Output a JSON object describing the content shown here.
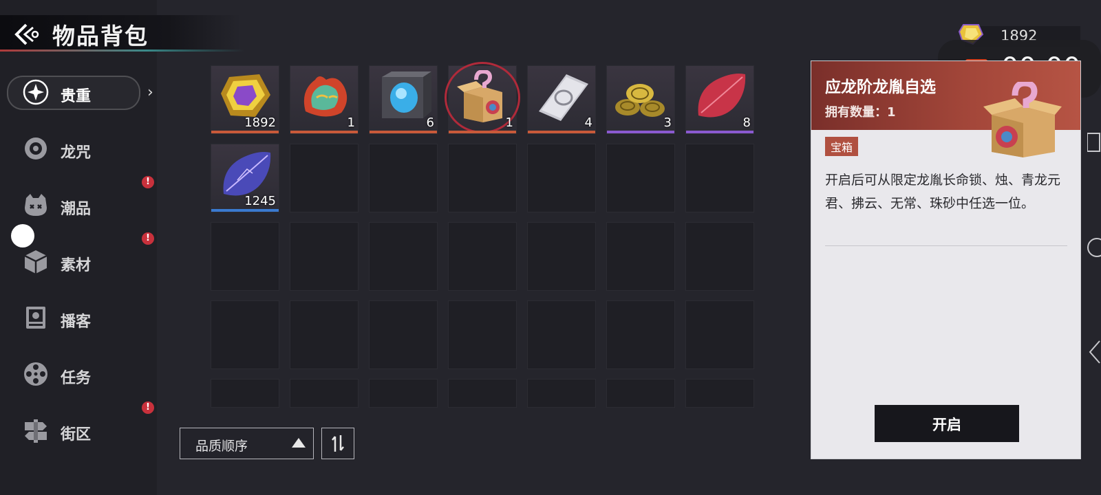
{
  "header": {
    "title": "物品背包",
    "back_icon": "back-arrow-icon"
  },
  "currency": {
    "value": "1892",
    "icon": "gem-icon"
  },
  "recording": {
    "time": "00:00",
    "color": "#d9421e"
  },
  "sidebar": {
    "items": [
      {
        "label": "贵重",
        "icon": "sparkle-icon",
        "active": true,
        "badge": ""
      },
      {
        "label": "龙咒",
        "icon": "ring-icon",
        "active": false,
        "badge": ""
      },
      {
        "label": "潮品",
        "icon": "cat-face-icon",
        "active": false,
        "badge": "!"
      },
      {
        "label": "素材",
        "icon": "box-icon",
        "active": false,
        "badge": "!"
      },
      {
        "label": "播客",
        "icon": "podcast-icon",
        "active": false,
        "badge": ""
      },
      {
        "label": "任务",
        "icon": "film-reel-icon",
        "active": false,
        "badge": ""
      },
      {
        "label": "街区",
        "icon": "signpost-icon",
        "active": false,
        "badge": "!"
      }
    ]
  },
  "inventory": {
    "items": [
      {
        "name": "gem",
        "count": "1892",
        "rarity_color": "#c85a3a"
      },
      {
        "name": "flame-mask",
        "count": "1",
        "rarity_color": "#c85a3a"
      },
      {
        "name": "blue-cube",
        "count": "6",
        "rarity_color": "#c85a3a"
      },
      {
        "name": "mystery-box",
        "count": "1",
        "rarity_color": "#c85a3a",
        "selected": true
      },
      {
        "name": "silver-ticket",
        "count": "4",
        "rarity_color": "#c85a3a"
      },
      {
        "name": "gold-coins",
        "count": "3",
        "rarity_color": "#8a5ad0"
      },
      {
        "name": "red-leaf",
        "count": "8",
        "rarity_color": "#8a5ad0"
      },
      {
        "name": "blue-leaf",
        "count": "1245",
        "rarity_color": "#3a7ad0"
      }
    ]
  },
  "sort": {
    "label": "品质顺序"
  },
  "detail": {
    "name": "应龙阶龙胤自选",
    "count_label": "拥有数量：1",
    "tag": "宝箱",
    "description": "开启后可从限定龙胤长命锁、烛、青龙元君、拂云、无常、珠砂中任选一位。",
    "open_label": "开启"
  }
}
